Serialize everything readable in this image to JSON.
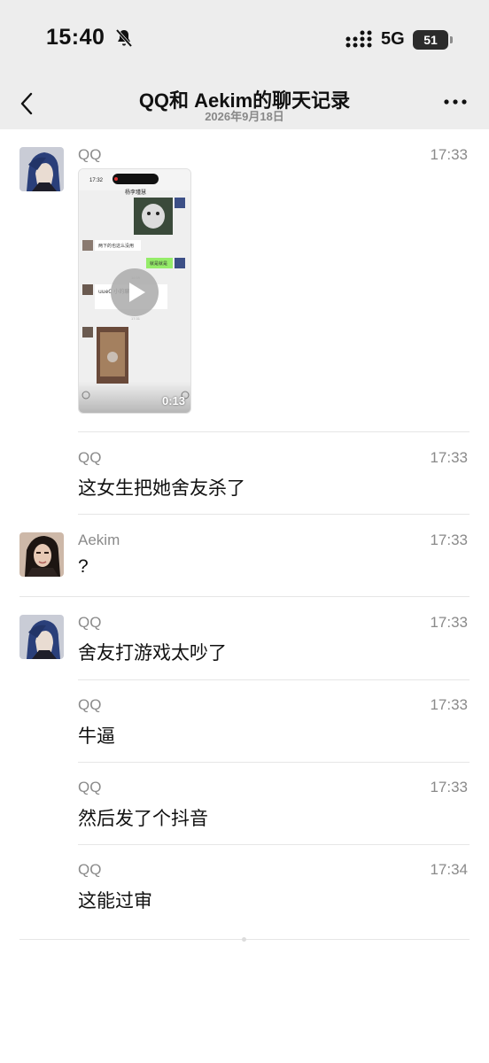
{
  "status_bar": {
    "time": "15:40",
    "network": "5G",
    "battery": "51"
  },
  "nav": {
    "title": "QQ和 Aekim的聊天记录",
    "date": "2026年9月18日"
  },
  "messages": [
    {
      "sender": "QQ",
      "time": "17:33",
      "type": "video",
      "duration": "0:13"
    },
    {
      "sender": "QQ",
      "time": "17:33",
      "text": "这女生把她舍友杀了"
    },
    {
      "sender": "Aekim",
      "time": "17:33",
      "text": "?"
    },
    {
      "sender": "QQ",
      "time": "17:33",
      "text": "舍友打游戏太吵了"
    },
    {
      "sender": "QQ",
      "time": "17:33",
      "text": "牛逼"
    },
    {
      "sender": "QQ",
      "time": "17:33",
      "text": "然后发了个抖音"
    },
    {
      "sender": "QQ",
      "time": "17:34",
      "text": "这能过审"
    }
  ],
  "video_preview": {
    "status_time": "17:32",
    "chat_title": "杨李瑾慧",
    "bubble_1": "两下的也这么没用",
    "bubble_2": "就是就是",
    "card_text": "uueC 小的聊天",
    "timestamp_1": "16:59",
    "timestamp_2": "17:31"
  },
  "colors": {
    "bar_bg": "#ededed",
    "secondary_text": "#8a8a8a",
    "divider": "#e6e6e6",
    "wechat_green": "#95ec69"
  }
}
